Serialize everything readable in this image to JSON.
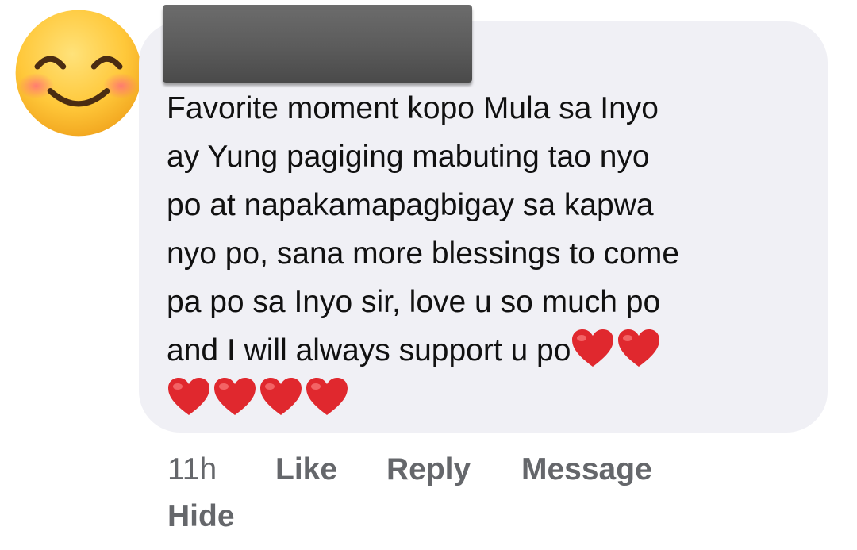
{
  "comment": {
    "avatar_icon": "smiling-face-with-smiling-eyes-icon",
    "author_name": "",
    "text_lines": [
      "Favorite moment kopo Mula sa Inyo",
      "ay Yung pagiging mabuting tao nyo",
      "po at napakamapagbigay sa kapwa",
      "nyo po, sana more blessings to come",
      "pa po sa Inyo sir, love u so much po",
      "and I will always support u po"
    ],
    "heart_icon": "red-heart-icon",
    "bubble_color": "#f0f0f5",
    "heart_color": "#e0282e"
  },
  "actions": {
    "timestamp": "11h",
    "like_label": "Like",
    "reply_label": "Reply",
    "message_label": "Message",
    "hide_label": "Hide",
    "color": "#65676b"
  }
}
